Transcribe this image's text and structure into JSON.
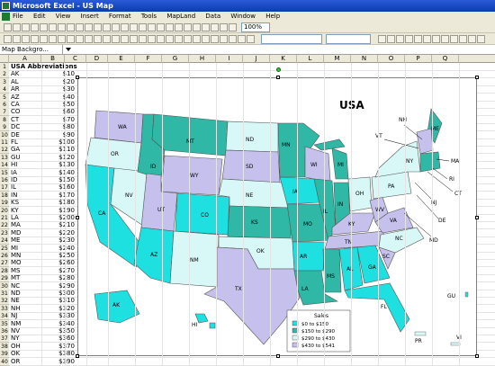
{
  "window": {
    "title": "Microsoft Excel - US Map"
  },
  "menu": [
    "File",
    "Edit",
    "View",
    "Insert",
    "Format",
    "Tools",
    "MapLand",
    "Data",
    "Window",
    "Help"
  ],
  "toolbar": {
    "zoom": "100%"
  },
  "namebox": "Map Backgro...",
  "columns": [
    "A",
    "B",
    "C",
    "D",
    "E",
    "F",
    "G",
    "H",
    "I",
    "J",
    "K",
    "L",
    "M",
    "N",
    "O",
    "P",
    "Q"
  ],
  "sheet": {
    "header": "USA Abbreviations",
    "rows": [
      [
        "AK",
        "$10"
      ],
      [
        "AL",
        "$20"
      ],
      [
        "AR",
        "$30"
      ],
      [
        "AZ",
        "$40"
      ],
      [
        "CA",
        "$50"
      ],
      [
        "CO",
        "$60"
      ],
      [
        "CT",
        "$70"
      ],
      [
        "DC",
        "$80"
      ],
      [
        "DE",
        "$90"
      ],
      [
        "FL",
        "$100"
      ],
      [
        "GA",
        "$110"
      ],
      [
        "GU",
        "$120"
      ],
      [
        "HI",
        "$130"
      ],
      [
        "IA",
        "$140"
      ],
      [
        "ID",
        "$150"
      ],
      [
        "IL",
        "$160"
      ],
      [
        "IN",
        "$170"
      ],
      [
        "KS",
        "$180"
      ],
      [
        "KY",
        "$190"
      ],
      [
        "LA",
        "$200"
      ],
      [
        "MA",
        "$210"
      ],
      [
        "MD",
        "$220"
      ],
      [
        "ME",
        "$230"
      ],
      [
        "MI",
        "$240"
      ],
      [
        "MN",
        "$250"
      ],
      [
        "MO",
        "$260"
      ],
      [
        "MS",
        "$270"
      ],
      [
        "MT",
        "$280"
      ],
      [
        "NC",
        "$290"
      ],
      [
        "ND",
        "$300"
      ],
      [
        "NE",
        "$310"
      ],
      [
        "NH",
        "$320"
      ],
      [
        "NJ",
        "$330"
      ],
      [
        "NM",
        "$340"
      ],
      [
        "NV",
        "$350"
      ],
      [
        "NY",
        "$360"
      ],
      [
        "OH",
        "$370"
      ],
      [
        "OK",
        "$380"
      ],
      [
        "OR",
        "$390"
      ]
    ]
  },
  "map": {
    "title": "USA",
    "legend": {
      "title": "Sales",
      "items": [
        {
          "label": "$0 to $150",
          "color": "#1fe0e0"
        },
        {
          "label": "$150 to $290",
          "color": "#2fb8a6"
        },
        {
          "label": "$290 to $430",
          "color": "#d8f8f8"
        },
        {
          "label": "$430 to $541",
          "color": "#c6c0ec"
        }
      ]
    },
    "states": [
      "WA",
      "OR",
      "CA",
      "NV",
      "ID",
      "MT",
      "WY",
      "UT",
      "AZ",
      "CO",
      "NM",
      "ND",
      "SD",
      "NE",
      "KS",
      "OK",
      "TX",
      "MN",
      "IA",
      "MO",
      "AR",
      "LA",
      "WI",
      "IL",
      "MS",
      "MI",
      "IN",
      "KY",
      "TN",
      "AL",
      "GA",
      "FL",
      "OH",
      "WV",
      "VA",
      "NC",
      "SC",
      "PA",
      "NY",
      "ME",
      "AK",
      "HI"
    ],
    "callouts": [
      "NH",
      "VT",
      "MA",
      "RI",
      "CT",
      "NJ",
      "DE",
      "MD",
      "GU",
      "PR",
      "VI"
    ]
  }
}
